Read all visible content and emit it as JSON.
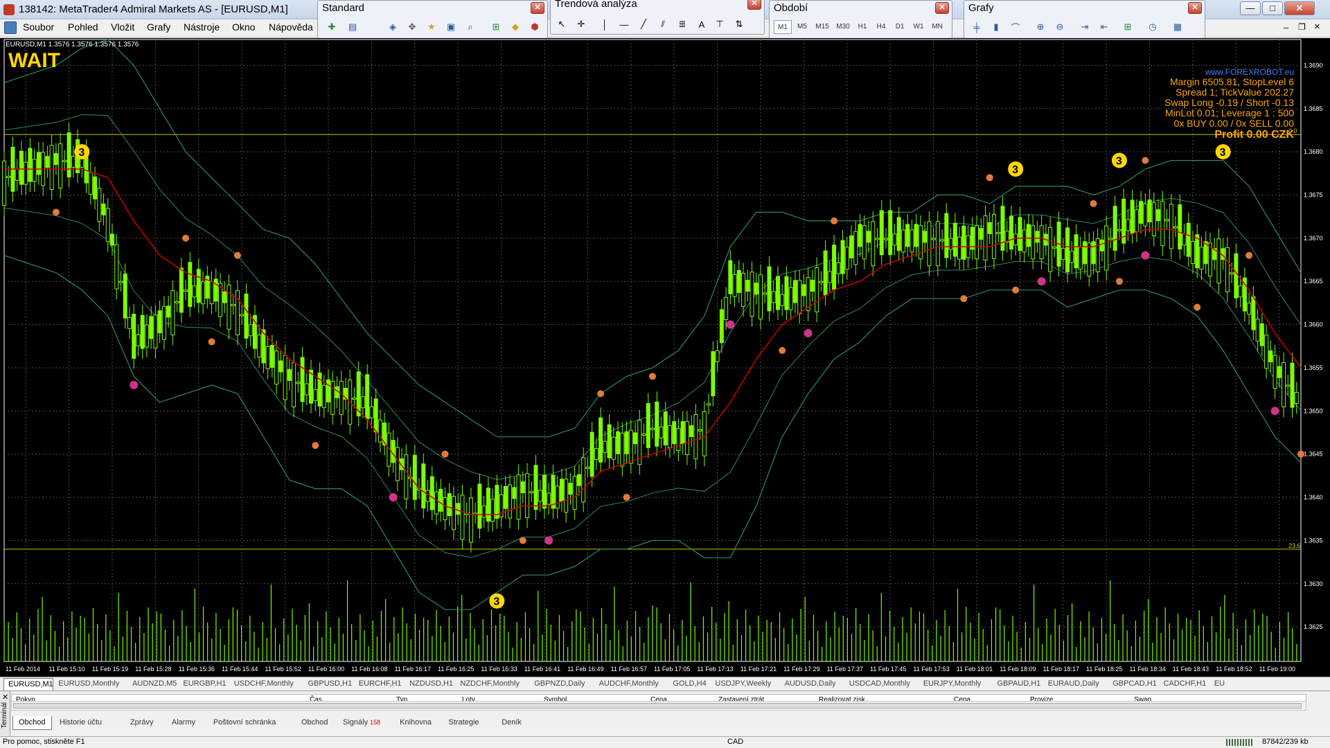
{
  "window": {
    "title": "138142: MetaTrader4 Admiral Markets AS - [EURUSD,M1]",
    "min": "—",
    "max": "□",
    "close": "✕",
    "doc_min": "–",
    "doc_restore": "❐",
    "doc_close": "×"
  },
  "menu": [
    "Soubor",
    "Pohled",
    "Vložit",
    "Grafy",
    "Nástroje",
    "Okno",
    "Nápověda"
  ],
  "toolbars": {
    "standard": {
      "title": "Standard"
    },
    "trend": {
      "title": "Trendová analýza",
      "buttons": [
        "A"
      ]
    },
    "period": {
      "title": "Období",
      "buttons": [
        "M1",
        "M5",
        "M15",
        "M30",
        "H1",
        "H4",
        "D1",
        "W1",
        "MN"
      ]
    },
    "grafy": {
      "title": "Grafy"
    }
  },
  "chart": {
    "symbol_line": "EURUSD,M1  1.3576 1.3576 1.3576 1.3576",
    "signal": "WAIT",
    "info_site": "www.FOREXROBOT.eu",
    "info_lines": [
      "Margin 6505.81, StopLevel 6",
      "Spread 1; TickValue 202.27",
      "Swap Long -0.19 / Short -0.13",
      "MinLot 0.01; Leverage 1 : 500",
      "0x BUY 0.00 / 0x SELL 0.00"
    ],
    "profit": "Profit 0.00 CZK",
    "marker_digit": "3",
    "fib_level_top": "0.0",
    "fib_level_bottom": "23.6",
    "colors": {
      "background": "#000000",
      "candles": "#7cfc00",
      "bollinger": "#2e8b57",
      "moving_average": "#cc0000",
      "fib_lines": "#c8c800",
      "orange_marker": "#e07b39",
      "magenta_marker": "#d0328c",
      "digit_marker": "#ffd700",
      "info_text": "#ffa500"
    }
  },
  "chart_data": {
    "type": "line",
    "title": "EURUSD,M1",
    "y_ticks": [
      "1.3690",
      "1.3685",
      "1.3680",
      "1.3675",
      "1.3670",
      "1.3665",
      "1.3660",
      "1.3655",
      "1.3650",
      "1.3645",
      "1.3640",
      "1.3635",
      "1.3630",
      "1.3625"
    ],
    "ylim": [
      1.3621,
      1.3693
    ],
    "x_ticks": [
      "11 Feb 2014",
      "11 Feb 15:10",
      "11 Feb 15:19",
      "11 Feb 15:28",
      "11 Feb 15:36",
      "11 Feb 15:44",
      "11 Feb 15:52",
      "11 Feb 16:00",
      "11 Feb 16:08",
      "11 Feb 16:17",
      "11 Feb 16:25",
      "11 Feb 16:33",
      "11 Feb 16:41",
      "11 Feb 16:49",
      "11 Feb 16:57",
      "11 Feb 17:05",
      "11 Feb 17:13",
      "11 Feb 17:21",
      "11 Feb 17:29",
      "11 Feb 17:37",
      "11 Feb 17:45",
      "11 Feb 17:53",
      "11 Feb 18:01",
      "11 Feb 18:09",
      "11 Feb 18:17",
      "11 Feb 18:25",
      "11 Feb 18:34",
      "11 Feb 18:43",
      "11 Feb 18:52",
      "11 Feb 19:00"
    ],
    "grid": true,
    "series": [
      {
        "values": [
          1.3677,
          1.3678,
          1.3679,
          1.3679,
          1.3672,
          1.3658,
          1.366,
          1.3664,
          1.3664,
          1.3662,
          1.3657,
          1.3654,
          1.3652,
          1.3652,
          1.3651,
          1.3645,
          1.3641,
          1.3639,
          1.3638,
          1.3639,
          1.3641,
          1.364,
          1.3641,
          1.3646,
          1.3646,
          1.3648,
          1.3647,
          1.3648,
          1.3665,
          1.3664,
          1.3663,
          1.3664,
          1.3666,
          1.367,
          1.367,
          1.367,
          1.367,
          1.3669,
          1.3671,
          1.367,
          1.367,
          1.3668,
          1.3668,
          1.3671,
          1.3673,
          1.3672,
          1.3668,
          1.3668,
          1.3662,
          1.3655,
          1.3651
        ]
      },
      {
        "values": [
          1.3678,
          1.3678,
          1.3678,
          1.3678,
          1.3677,
          1.3672,
          1.3668,
          1.3666,
          1.3665,
          1.3663,
          1.3659,
          1.3656,
          1.3654,
          1.3652,
          1.3649,
          1.3645,
          1.3641,
          1.3639,
          1.3638,
          1.3638,
          1.3639,
          1.3639,
          1.364,
          1.3643,
          1.3644,
          1.3645,
          1.3646,
          1.3647,
          1.3651,
          1.3656,
          1.366,
          1.3662,
          1.3664,
          1.3665,
          1.3667,
          1.3668,
          1.3669,
          1.3669,
          1.3669,
          1.367,
          1.367,
          1.3669,
          1.3669,
          1.367,
          1.3671,
          1.3671,
          1.367,
          1.3668,
          1.3664,
          1.3659,
          1.3655
        ]
      }
    ]
  },
  "chart_tabs": [
    "EURUSD,M1",
    "EURUSD,M1",
    "EURUSD,Monthly",
    "AUDNZD,M5",
    "EURGBP,H1",
    "USDCHF,Monthly",
    "GBPUSD,H1",
    "EURCHF,H1",
    "NZDUSD,H1",
    "NZDCHF,Monthly",
    "GBPNZD,Daily",
    "AUDCHF,Monthly",
    "GOLD,H4",
    "USDJPY,Weekly",
    "AUDUSD,Daily",
    "USDCAD,Monthly",
    "EURJPY,Monthly",
    "GBPAUD,H1",
    "EURAUD,Daily",
    "GBPCAD,H1",
    "CADCHF,H1",
    "EU"
  ],
  "terminal": {
    "side_label": "Terminál",
    "columns": [
      "Pokyn",
      "Čas",
      "Typ",
      "Loty",
      "Symbol",
      "Cena",
      "Zastavení ztrát",
      "Realizovat zisk",
      "Cena",
      "Provize",
      "Swap"
    ],
    "tabs": [
      "Obchod",
      "Historie účtu",
      "Zprávy",
      "Alarmy",
      "Poštovní schránka",
      "Obchod",
      "Signály",
      "Knihovna",
      "Strategie",
      "Deník"
    ],
    "signals_badge": "158"
  },
  "status": {
    "help": "Pro pomoc, stiskněte F1",
    "profile": "CAD",
    "traffic": "87842/239 kb"
  }
}
